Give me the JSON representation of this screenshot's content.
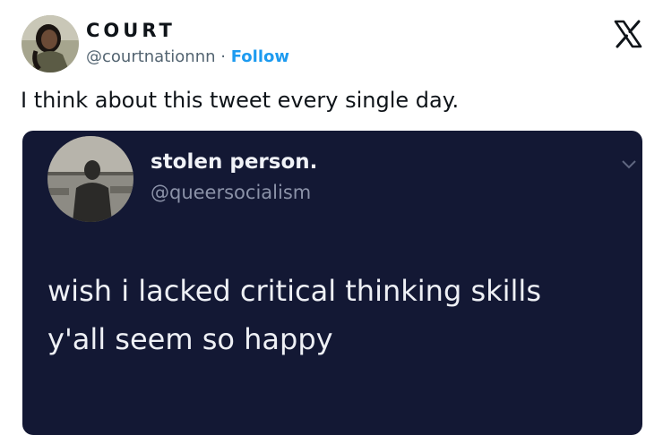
{
  "author": {
    "name": "COURT",
    "handle": "@courtnationnn",
    "separator": "·",
    "follow_label": "Follow"
  },
  "brand": {
    "logo_icon": "x-logo-icon"
  },
  "tweet": {
    "text": "I think about this tweet every single day."
  },
  "quoted_screenshot": {
    "name": "stolen person.",
    "handle": "@queersocialism",
    "line1": "wish i lacked critical thinking skills",
    "line2": "y'all seem so happy"
  },
  "colors": {
    "follow": "#1d9bf0",
    "screenshot_bg": "#131834",
    "muted": "#536471"
  }
}
